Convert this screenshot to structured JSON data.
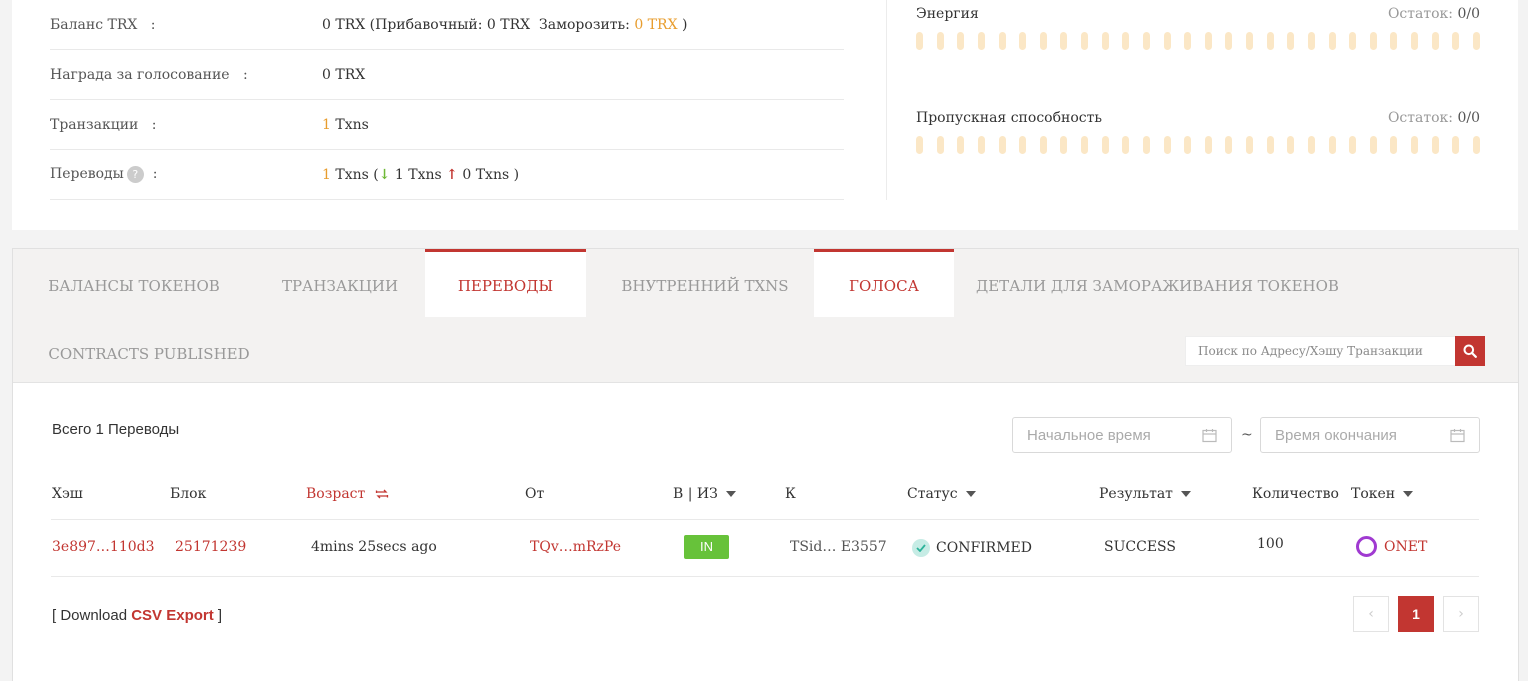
{
  "account": {
    "balance": {
      "label": "Баланс TRX",
      "sep": ":",
      "prefix": "0 TRX (Прибавочный: 0 TRX  Заморозить: ",
      "freeze": "0 TRX",
      "suffix": " )"
    },
    "reward": {
      "label": "Награда за голосование",
      "sep": ":",
      "value": "0 TRX"
    },
    "transactions": {
      "label": "Транзакции",
      "sep": ":",
      "count": "1",
      "unit": "Txns"
    },
    "transfers": {
      "label": "Переводы",
      "help": "?",
      "sep": ":",
      "count": "1",
      "unit": "Txns (",
      "in_value": "1 Txns",
      "out_value": "0 Txns",
      "close": ")"
    }
  },
  "resources": {
    "energy": {
      "label": "Энергия",
      "remaining_label": "Остаток:",
      "remaining_value": "0/0",
      "used_fraction": 0
    },
    "bandwidth": {
      "label": "Пропускная способность",
      "remaining_label": "Остаток:",
      "remaining_value": "0/0",
      "used_fraction": 0
    }
  },
  "tabs": [
    {
      "label": "БАЛАНСЫ ТОКЕНОВ",
      "active": false
    },
    {
      "label": "ТРАНЗАКЦИИ",
      "active": false
    },
    {
      "label": "ПЕРЕВОДЫ",
      "active": true
    },
    {
      "label": "ВНУТРЕННИЙ TXNS",
      "active": false
    },
    {
      "label": "ГОЛОСА",
      "active": true
    },
    {
      "label": "ДЕТАЛИ ДЛЯ ЗАМОРАЖИВАНИЯ ТОКЕНОВ",
      "active": false
    },
    {
      "label": "CONTRACTS PUBLISHED",
      "active": false
    }
  ],
  "search": {
    "placeholder": "Поиск по Адресу/Хэшу Транзакции",
    "icon": "search-icon"
  },
  "transfers_list": {
    "total": "Всего 1 Переводы",
    "start_placeholder": "Начальное время",
    "end_placeholder": "Время окончания",
    "range_sep": "~",
    "columns": {
      "hash": "Хэш",
      "block": "Блок",
      "age": "Возраст",
      "from": "От",
      "direction": "В | ИЗ",
      "to": "К",
      "status": "Статус",
      "result": "Результат",
      "amount": "Количество",
      "token": "Токен"
    },
    "rows": [
      {
        "hash": "3e897…110d3",
        "block": "25171239",
        "age": "4mins 25secs ago",
        "from": "TQv…mRzPe",
        "direction": "IN",
        "to": "TSid… E3557",
        "status": "CONFIRMED",
        "result": "SUCCESS",
        "amount": "100",
        "token": "ONET"
      }
    ],
    "download": {
      "open": "[ Download ",
      "link": "CSV Export",
      "close": " ]"
    },
    "pagination": {
      "prev": "‹",
      "current": "1",
      "next": "›"
    }
  },
  "colors": {
    "accent": "#c23631",
    "orange": "#e89d2e",
    "green": "#67c23a",
    "token_ring": "#a03ad1"
  }
}
